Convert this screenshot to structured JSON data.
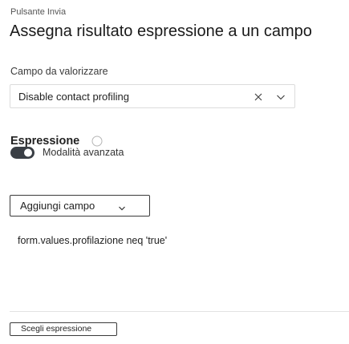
{
  "header": {
    "subtitle": "Pulsante Invia",
    "title": "Assegna risultato espressione a un campo"
  },
  "target_field": {
    "label": "Campo da valorizzare",
    "value": "Disable contact profiling",
    "clear_icon": "close-icon",
    "dropdown_icon": "chevron-down-icon"
  },
  "expression": {
    "heading": "Espressione",
    "info_icon": "info-circle-icon",
    "advanced_mode": {
      "label": "Modalità avanzata",
      "enabled": true
    },
    "add_field_button": {
      "label": "Aggiungi campo",
      "icon": "chevron-down-icon"
    },
    "value": "form.values.profilazione neq 'true'",
    "choose_expression_button": {
      "label": "Scegli espressione"
    }
  },
  "colors": {
    "text": "#1f1f1f",
    "muted": "#555555",
    "border": "#dcdcdc",
    "toggle": "#3a3f45"
  }
}
